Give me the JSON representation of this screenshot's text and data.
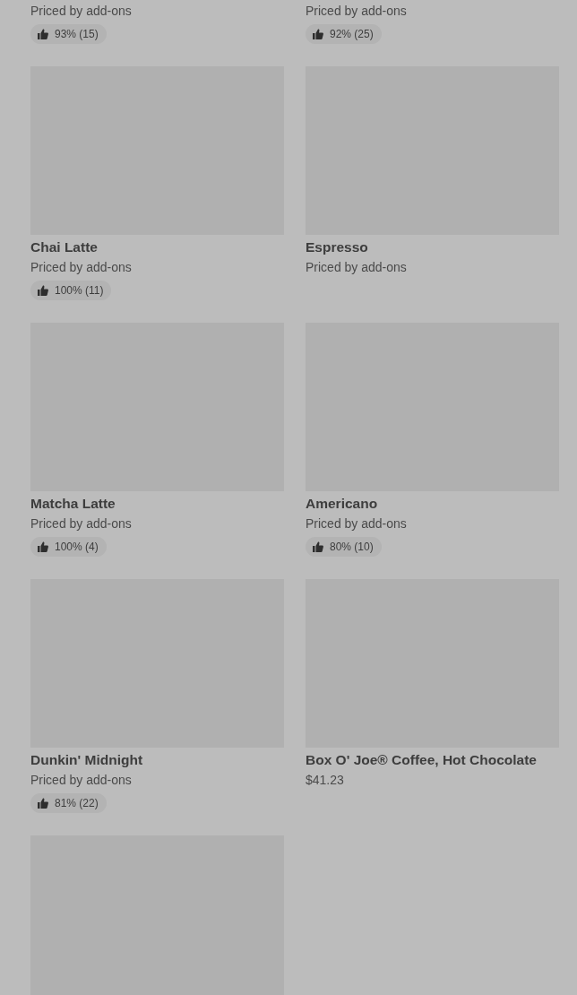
{
  "items": [
    {
      "subtitle": "Priced by add-ons",
      "rating": "93% (15)"
    },
    {
      "subtitle": "Priced by add-ons",
      "rating": "92% (25)"
    },
    {
      "image": {
        "kind": "placeholder"
      },
      "title": "Chai Latte",
      "subtitle": "Priced by add-ons",
      "rating": "100% (11)"
    },
    {
      "image": {
        "kind": "placeholder"
      },
      "title": "Espresso",
      "subtitle": "Priced by add-ons"
    },
    {
      "image": {
        "kind": "placeholder"
      },
      "title": "Matcha Latte",
      "subtitle": "Priced by add-ons",
      "rating": "100% (4)"
    },
    {
      "image": {
        "kind": "placeholder"
      },
      "title": "Americano",
      "subtitle": "Priced by add-ons",
      "rating": "80% (10)"
    },
    {
      "image": {
        "kind": "placeholder"
      },
      "title": "Dunkin' Midnight",
      "subtitle": "Priced by add-ons",
      "rating": "81% (22)"
    },
    {
      "image": {
        "kind": "placeholder"
      },
      "title": "Box O' Joe® Coffee, Hot Chocolate",
      "subtitle": "$41.23"
    },
    {
      "image": {
        "kind": "placeholder"
      }
    }
  ]
}
